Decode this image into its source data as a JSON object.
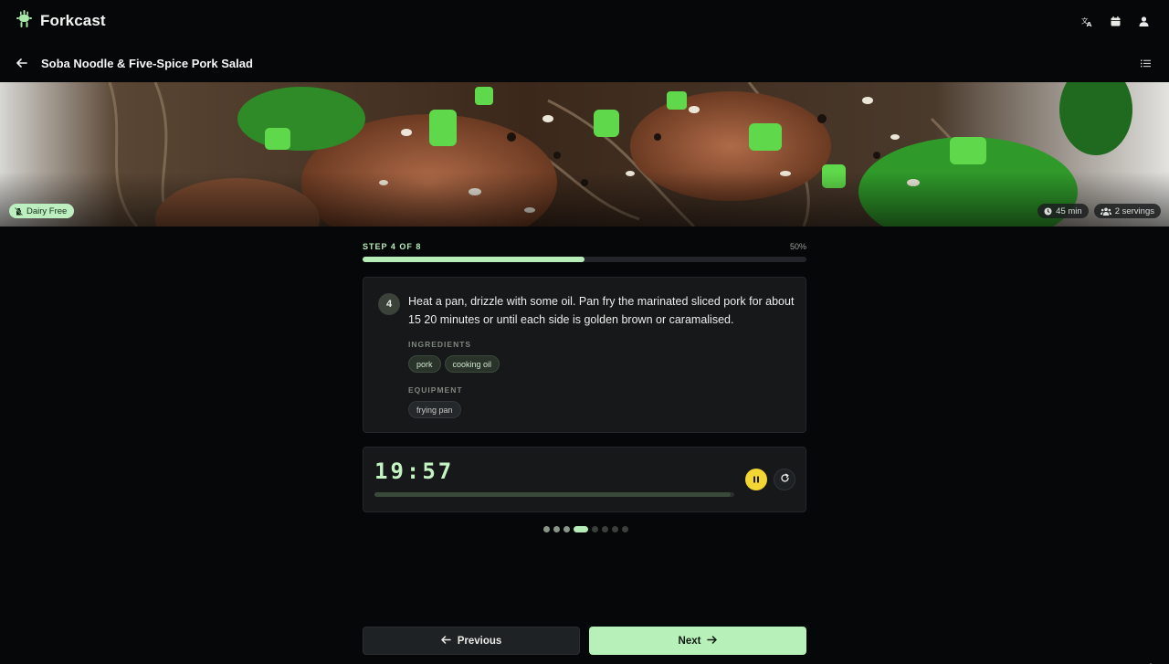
{
  "app": {
    "name": "Forkcast"
  },
  "header": {
    "icons": [
      "translate-icon",
      "calendar-icon",
      "account-icon"
    ]
  },
  "recipe": {
    "title": "Soba Noodle & Five-Spice Pork Salad"
  },
  "hero": {
    "diet_tag": "Dairy Free",
    "time": "45 min",
    "servings": "2 servings"
  },
  "progress": {
    "label": "STEP 4 OF 8",
    "percent_label": "50%",
    "fraction": 0.5
  },
  "step": {
    "number": "4",
    "text": "Heat a pan, drizzle with some oil. Pan fry the marinated sliced pork for about 15 20 minutes or until each side is golden brown or caramalised.",
    "ingredients_label": "INGREDIENTS",
    "ingredients": [
      "pork",
      "cooking oil"
    ],
    "equipment_label": "EQUIPMENT",
    "equipment": [
      "frying pan"
    ]
  },
  "timer": {
    "display": "19:57",
    "remaining_fraction": 0.99,
    "state": "running"
  },
  "pagination": {
    "total": 8,
    "current": 4
  },
  "nav": {
    "previous": "Previous",
    "next": "Next"
  },
  "colors": {
    "accent": "#b8f0b9",
    "timer_button": "#f3d534",
    "background": "#060708"
  }
}
